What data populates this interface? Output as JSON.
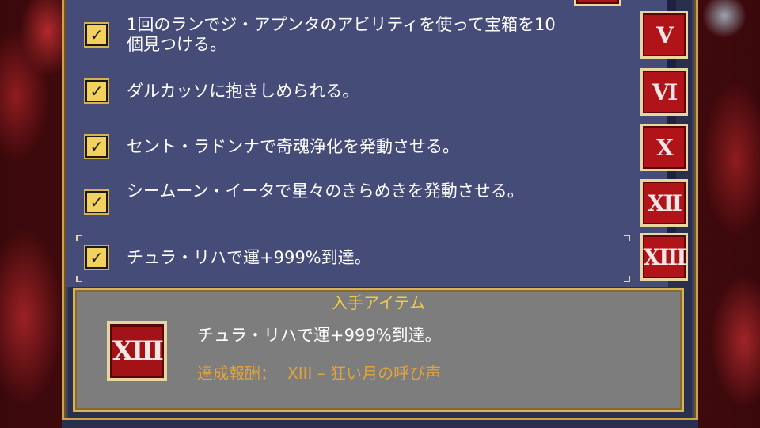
{
  "achievements": [
    {
      "text": "1回のランでジ・アプンタのアビリティを使って宝箱を10個見つける。",
      "numeral": "V",
      "checked": true
    },
    {
      "text": "ダルカッソに抱きしめられる。",
      "numeral": "VI",
      "checked": true
    },
    {
      "text": "セント・ラドンナで奇魂浄化を発動させる。",
      "numeral": "X",
      "checked": true
    },
    {
      "text": "シームーン・イータで星々のきらめきを発動させる。",
      "numeral": "XII",
      "checked": true
    },
    {
      "text": "チュラ・リハで運+999%到達。",
      "numeral": "XIII",
      "checked": true
    }
  ],
  "check_glyph": "✓",
  "detail": {
    "title": "入手アイテム",
    "numeral": "XIII",
    "description": "チュラ・リハで運+999%到達。",
    "reward_label": "達成報酬：",
    "reward_value": "XIII – 狂い月の呼び声"
  },
  "colors": {
    "list_bg": "#464c78",
    "badge_red": "#b01418",
    "gold_border": "#c9a24a",
    "title_yellow": "#f2c94c",
    "reward_orange": "#e0a43e"
  }
}
